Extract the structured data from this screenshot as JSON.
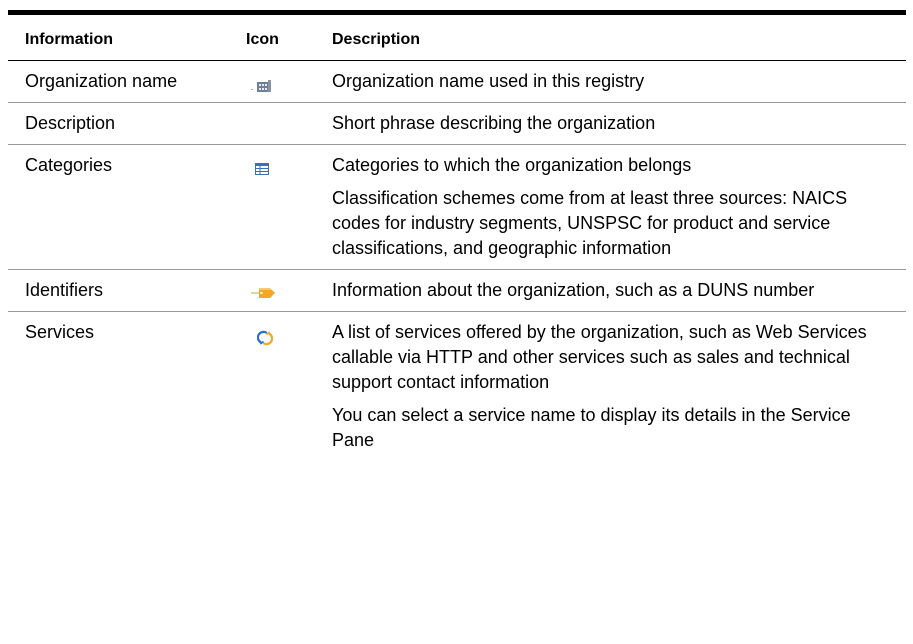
{
  "table": {
    "headers": {
      "information": "Information",
      "icon": "Icon",
      "description": "Description"
    },
    "rows": [
      {
        "information": "Organization name",
        "icon": "building-icon",
        "description": [
          "Organization name used in this registry"
        ]
      },
      {
        "information": "Description",
        "icon": "",
        "description": [
          "Short phrase describing the organization"
        ]
      },
      {
        "information": "Categories",
        "icon": "table-grid-icon",
        "description": [
          "Categories to which the organization belongs",
          "Classification schemes come from at least three sources: NAICS codes for industry segments, UNSPSC for product and service classifications, and geographic information"
        ]
      },
      {
        "information": "Identifiers",
        "icon": "tag-icon",
        "description": [
          "Information about the organization, such as a DUNS number"
        ]
      },
      {
        "information": "Services",
        "icon": "service-cycle-icon",
        "description": [
          "A list of services offered by the organization, such as Web Services callable via HTTP and other services such as sales and technical support contact information",
          "You can select a service name to display its details in the Service Pane"
        ]
      }
    ]
  },
  "colors": {
    "rule": "#000000",
    "row_divider": "#999999",
    "icon_blue": "#3b6fb6",
    "icon_orange": "#f5a623"
  }
}
